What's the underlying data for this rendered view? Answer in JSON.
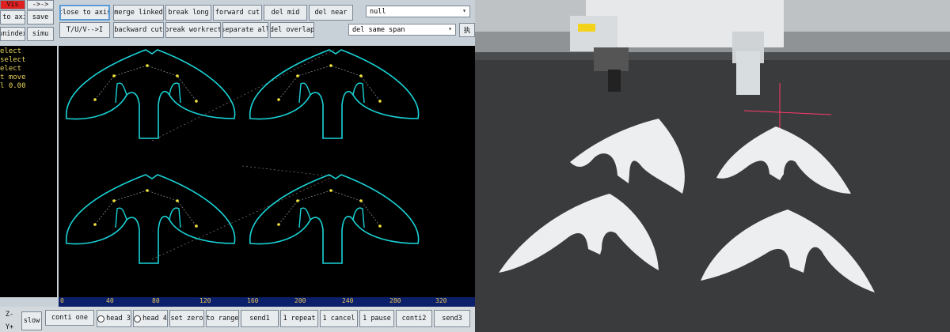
{
  "toolbar": {
    "side_labels": [
      "Vis",
      "->->",
      "Z to axis",
      "save",
      "unindex",
      "simu"
    ],
    "row1": [
      "close to axis",
      "merge linked",
      "break long",
      "forward cut",
      "del mid",
      "del near"
    ],
    "row2": [
      "T/U/V-->I",
      "backward cut",
      "break workrect",
      "separate all",
      "del overlap"
    ],
    "dropdown1_value": "null",
    "dropdown2_value": "del same span",
    "exec_label": "执"
  },
  "console": {
    "lines": [
      "elect",
      "select",
      "elect",
      "t move",
      "l 0.00"
    ]
  },
  "ruler": {
    "ticks": [
      "0",
      "40",
      "80",
      "120",
      "160",
      "200",
      "240",
      "280",
      "320"
    ]
  },
  "bottom_bar": {
    "left_label_top": "Z-",
    "left_label_bottom": "Y+",
    "buttons": [
      "slow",
      "conti one",
      "head 3",
      "head 4",
      "set zero",
      "to range",
      "send1",
      "1 repeat",
      "1 cancel",
      "1 pause",
      "conti2",
      "send3"
    ]
  },
  "colors": {
    "outline": "#19d3d6",
    "dot": "#f5e63a",
    "canvas": "#000000",
    "ruler": "#0c1f6b",
    "active_border": "#5b9bd5"
  }
}
